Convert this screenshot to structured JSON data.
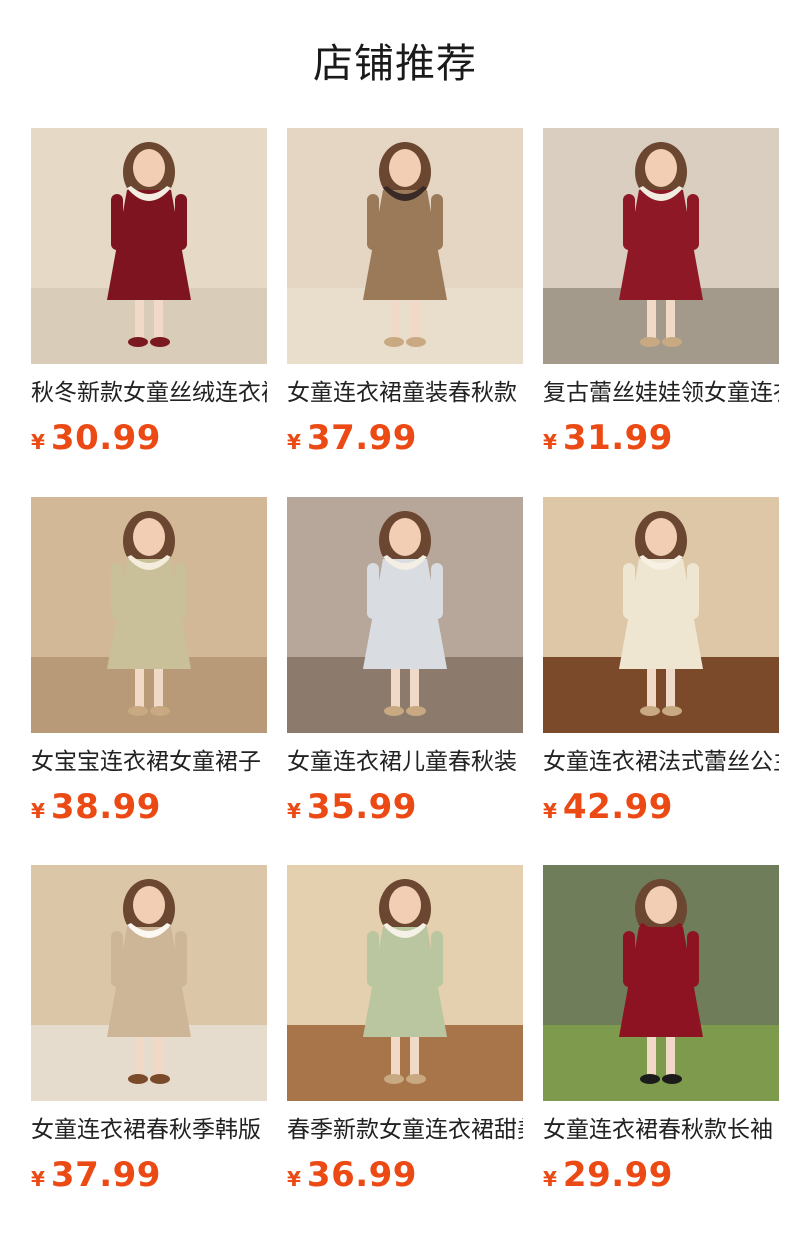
{
  "page": {
    "title": "店铺推荐"
  },
  "colors": {
    "price": "#ec4a14",
    "text": "#222222",
    "background": "#ffffff"
  },
  "products": [
    {
      "name": "秋冬新款女童丝绒连衣裙",
      "currency": "¥",
      "price": "30.99",
      "image": "girl-in-burgundy-velvet-dress",
      "bg": "#e6d9c6",
      "floor": "#d9ccb8",
      "dress": "#7d1420",
      "collar": "#f4eee2",
      "shoe": "#7a1a20"
    },
    {
      "name": "女童连衣裙童装春秋款",
      "currency": "¥",
      "price": "37.99",
      "image": "girl-in-khaki-dress-floral-collar",
      "bg": "#e4d6c2",
      "floor": "#e9ddcc",
      "dress": "#9b7a5a",
      "collar": "#3a2a26",
      "shoe": "#c8a982"
    },
    {
      "name": "复古蕾丝娃娃领女童连衣裙",
      "currency": "¥",
      "price": "31.99",
      "image": "girl-in-red-dress-lace-collar",
      "bg": "#d9cebf",
      "floor": "#a49a8c",
      "dress": "#8f1826",
      "collar": "#f2ece0",
      "shoe": "#c8a982"
    },
    {
      "name": "女宝宝连衣裙女童裙子",
      "currency": "¥",
      "price": "38.99",
      "image": "girl-in-sage-embroidered-dress",
      "bg": "#d2b896",
      "floor": "#b89a78",
      "dress": "#c9bf98",
      "collar": "#f4eddc",
      "shoe": "#c8a982"
    },
    {
      "name": "女童连衣裙儿童春秋装",
      "currency": "¥",
      "price": "35.99",
      "image": "girl-in-blue-floral-tiered-dress",
      "bg": "#b7a79a",
      "floor": "#8c7a6c",
      "dress": "#d9dde2",
      "collar": "#f4efe4",
      "shoe": "#c8a982"
    },
    {
      "name": "女童连衣裙法式蕾丝公主裙",
      "currency": "¥",
      "price": "42.99",
      "image": "girl-in-cream-lace-dress",
      "bg": "#ddc7a6",
      "floor": "#7a4a2a",
      "dress": "#efe6d2",
      "collar": "#f7f1e4",
      "shoe": "#c8a982"
    },
    {
      "name": "女童连衣裙春秋季韩版",
      "currency": "¥",
      "price": "37.99",
      "image": "girl-in-plaid-dress-white-collar",
      "bg": "#dcc6a8",
      "floor": "#e6dccd",
      "dress": "#cdb698",
      "collar": "#fbf8f2",
      "shoe": "#7a4a2a"
    },
    {
      "name": "春季新款女童连衣裙甜美",
      "currency": "¥",
      "price": "36.99",
      "image": "girl-in-mint-green-lace-dress",
      "bg": "#e4d0ae",
      "floor": "#a8744a",
      "dress": "#b9c6a0",
      "collar": "#f6f1e6",
      "shoe": "#c8a982"
    },
    {
      "name": "女童连衣裙春秋款长袖",
      "currency": "¥",
      "price": "29.99",
      "image": "girl-in-red-velvet-dress-outdoor",
      "bg": "#6f7d5a",
      "floor": "#7e9a4c",
      "dress": "#8e1322",
      "collar": "#8e1322",
      "shoe": "#1b1b1b"
    }
  ]
}
